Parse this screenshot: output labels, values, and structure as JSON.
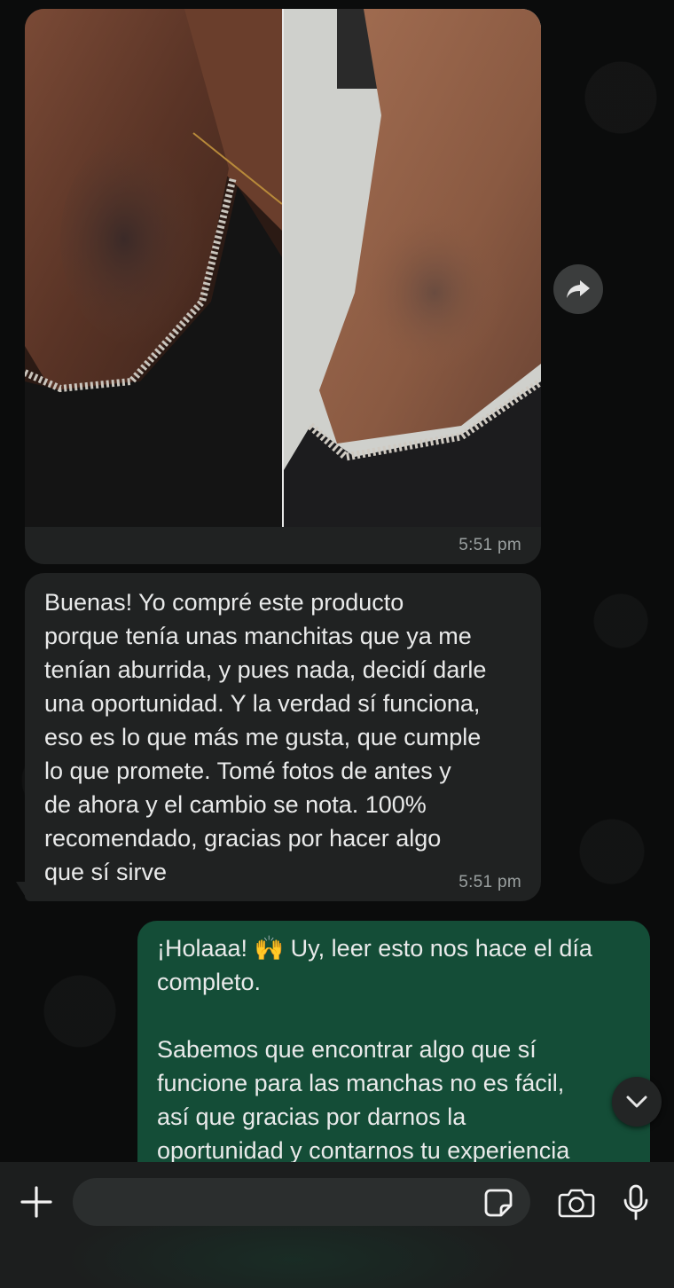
{
  "messages": {
    "image_message": {
      "time": "5:51 pm"
    },
    "incoming_text": {
      "text": "Buenas! Yo compré este producto\nporque tenía unas manchitas que ya me\ntenían aburrida, y pues nada, decidí darle\nuna oportunidad. Y la verdad sí funciona,\neso es lo que más me gusta, que cumple\nlo que promete. Tomé fotos de antes y\nde ahora y el cambio se nota. 100%\nrecomendado, gracias por hacer algo\nque sí sirve",
      "time": "5:51 pm"
    },
    "outgoing_text": {
      "text": "¡Holaaa! 🙌 Uy, leer esto nos hace el día\ncompleto.\n\nSabemos que encontrar algo que sí\nfuncione para las manchas no es fácil,\nasí que gracias por darnos la\noportunidad y contarnos tu experiencia"
    }
  },
  "composer": {
    "input_value": "",
    "input_placeholder": ""
  },
  "icons": {
    "forward": "forward-arrow-icon",
    "scroll_down": "chevron-down-icon",
    "add": "plus-icon",
    "sticker": "sticker-icon",
    "camera": "camera-icon",
    "mic": "microphone-icon"
  },
  "colors": {
    "incoming_bubble": "#202222",
    "outgoing_bubble": "#144d37",
    "background": "#0b0c0c"
  }
}
